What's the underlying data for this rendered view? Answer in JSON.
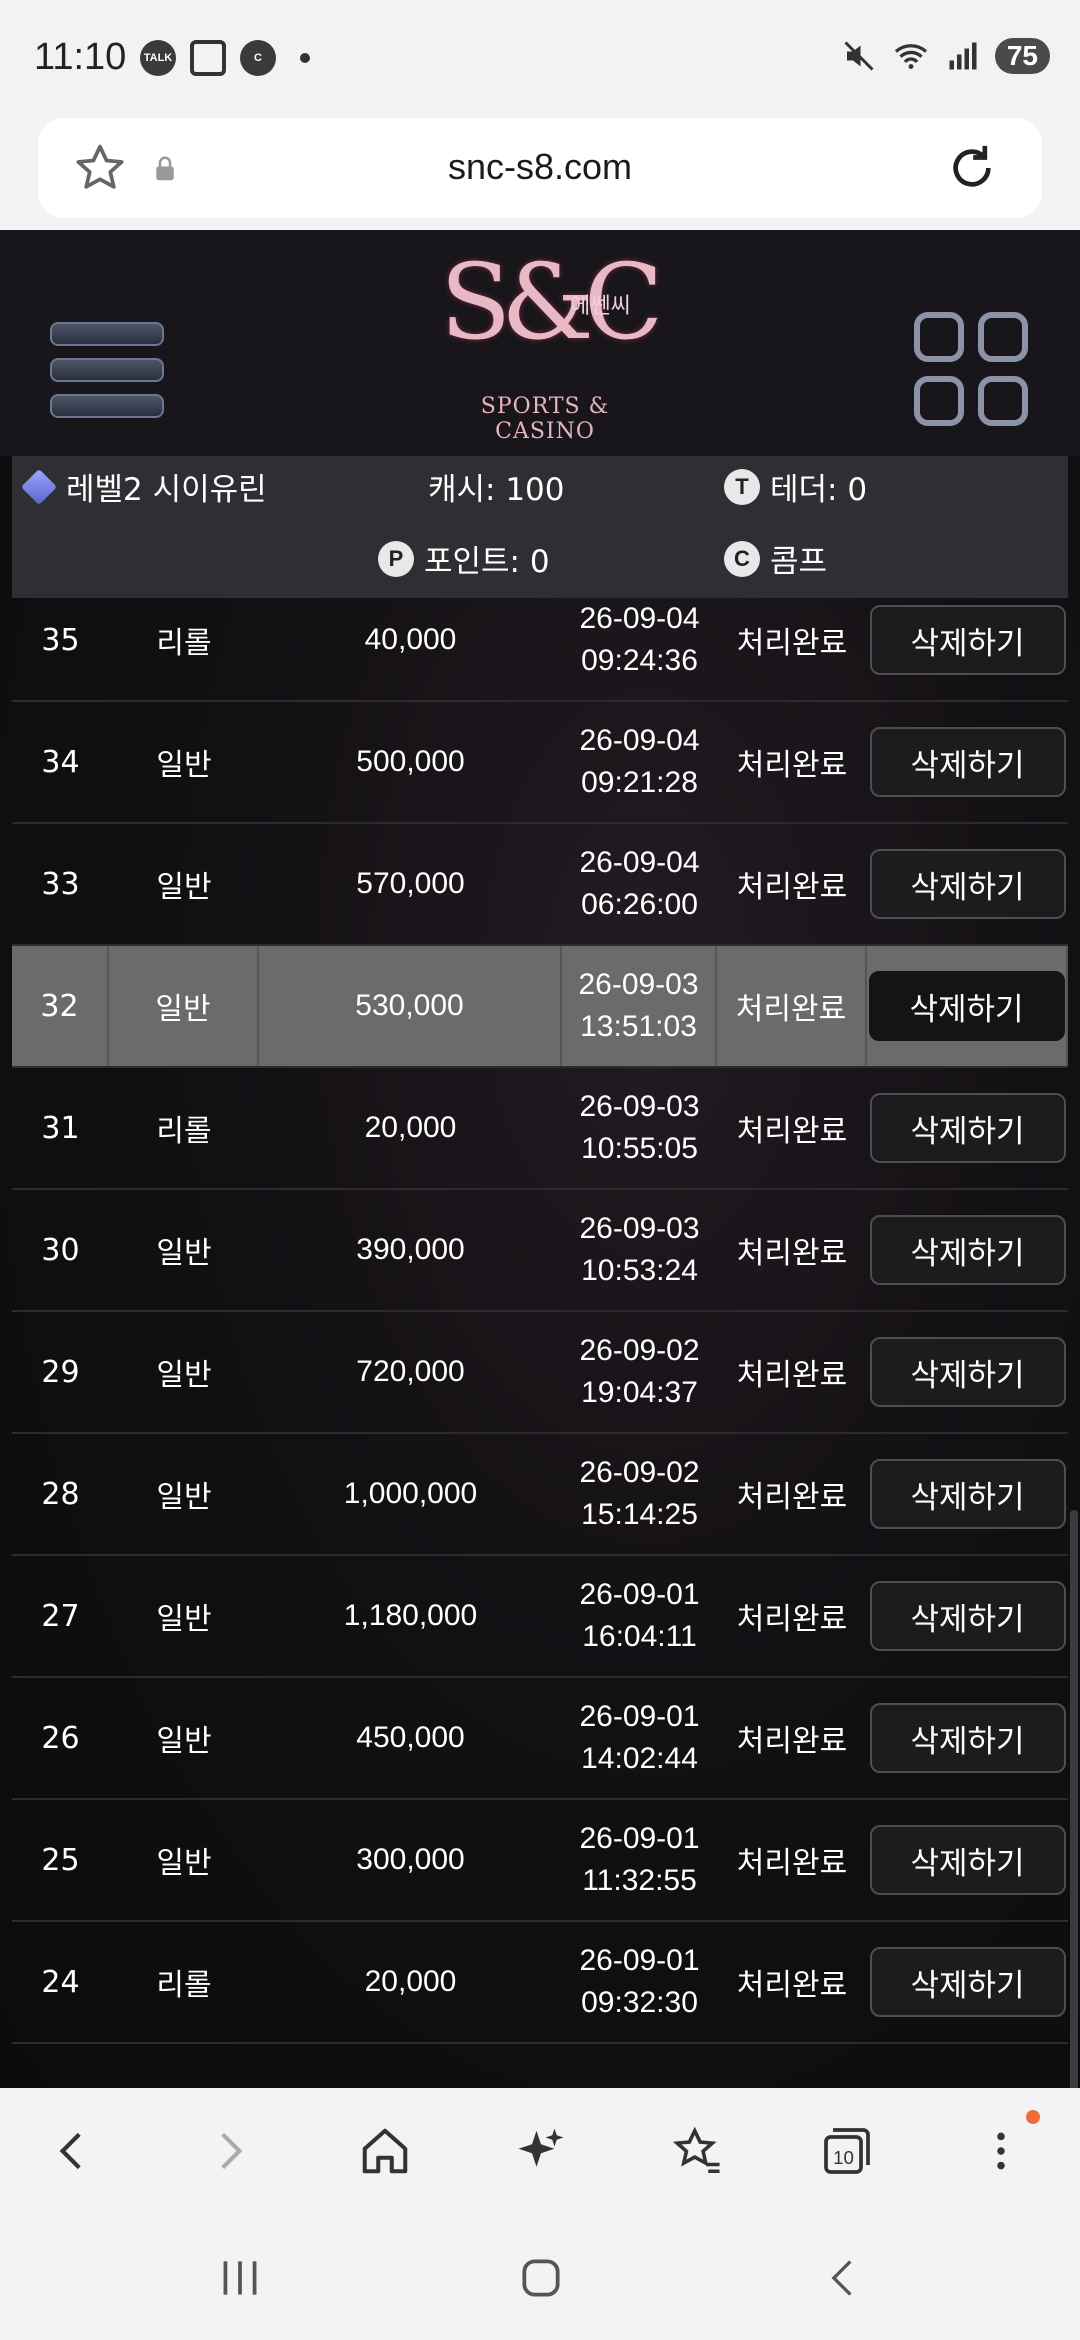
{
  "status_bar": {
    "time": "11:10",
    "left_icons": [
      "talk-notification-icon",
      "screenshot-icon",
      "c-app-icon"
    ],
    "battery": "75"
  },
  "browser": {
    "url": "snc-s8.com",
    "bottom_tabs_count": "10"
  },
  "site": {
    "logo_mark": "S&C",
    "logo_korean": "에쎈씨",
    "logo_subtitle": "SPORTS & CASINO"
  },
  "info": {
    "level": "레벨2 시이유린",
    "cash": "캐시: 100",
    "tether": "테더: 0",
    "points": "포인트: 0",
    "comp": "콤프",
    "tether_badge": "T",
    "points_badge": "P",
    "comp_badge": "C"
  },
  "delete_label": "삭제하기",
  "rows": [
    {
      "no": "35",
      "type": "리롤",
      "amount": "40,000",
      "date": "26-09-04",
      "time": "09:24:36",
      "status": "처리완료"
    },
    {
      "no": "34",
      "type": "일반",
      "amount": "500,000",
      "date": "26-09-04",
      "time": "09:21:28",
      "status": "처리완료"
    },
    {
      "no": "33",
      "type": "일반",
      "amount": "570,000",
      "date": "26-09-04",
      "time": "06:26:00",
      "status": "처리완료"
    },
    {
      "no": "32",
      "type": "일반",
      "amount": "530,000",
      "date": "26-09-03",
      "time": "13:51:03",
      "status": "처리완료"
    },
    {
      "no": "31",
      "type": "리롤",
      "amount": "20,000",
      "date": "26-09-03",
      "time": "10:55:05",
      "status": "처리완료"
    },
    {
      "no": "30",
      "type": "일반",
      "amount": "390,000",
      "date": "26-09-03",
      "time": "10:53:24",
      "status": "처리완료"
    },
    {
      "no": "29",
      "type": "일반",
      "amount": "720,000",
      "date": "26-09-02",
      "time": "19:04:37",
      "status": "처리완료"
    },
    {
      "no": "28",
      "type": "일반",
      "amount": "1,000,000",
      "date": "26-09-02",
      "time": "15:14:25",
      "status": "처리완료"
    },
    {
      "no": "27",
      "type": "일반",
      "amount": "1,180,000",
      "date": "26-09-01",
      "time": "16:04:11",
      "status": "처리완료"
    },
    {
      "no": "26",
      "type": "일반",
      "amount": "450,000",
      "date": "26-09-01",
      "time": "14:02:44",
      "status": "처리완료"
    },
    {
      "no": "25",
      "type": "일반",
      "amount": "300,000",
      "date": "26-09-01",
      "time": "11:32:55",
      "status": "처리완료"
    },
    {
      "no": "24",
      "type": "리롤",
      "amount": "20,000",
      "date": "26-09-01",
      "time": "09:32:30",
      "status": "처리완료"
    }
  ],
  "colors": {
    "highlight_row": "#6b6b6b",
    "page_bg": "#0d0c0f",
    "notification_dot": "#f26b3a"
  }
}
